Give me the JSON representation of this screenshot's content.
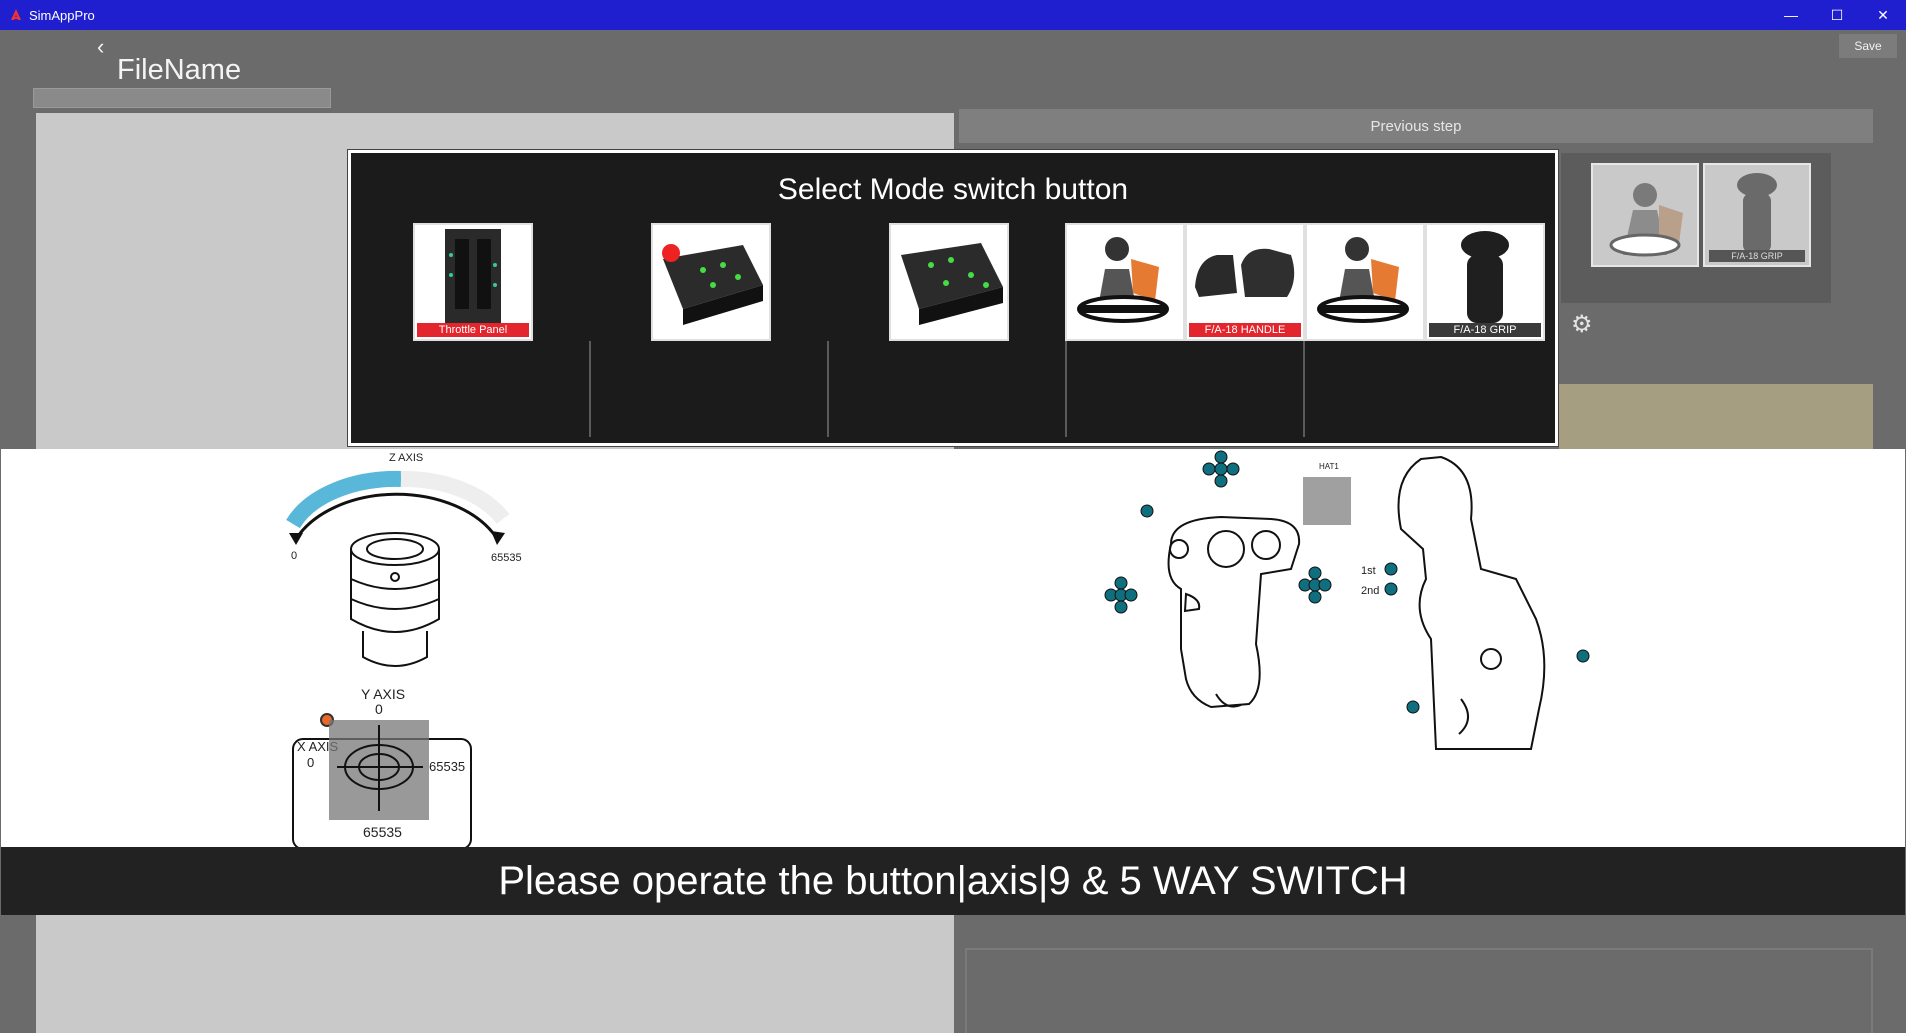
{
  "window": {
    "title": "SimAppPro",
    "minimize": "—",
    "maximize": "☐",
    "close": "✕"
  },
  "toolbar": {
    "back_icon": "‹",
    "filename": "FileName",
    "save": "Save"
  },
  "right": {
    "previous_step": "Previous step",
    "thumbs": [
      {
        "name": "orion",
        "label": ""
      },
      {
        "name": "fa18-grip",
        "label": "F/A-18 GRIP"
      }
    ]
  },
  "modal": {
    "title": "Select Mode switch button",
    "devices": [
      {
        "name": "throttle-panel",
        "label": "Throttle Panel",
        "label_style": "red"
      },
      {
        "name": "control-panel-1",
        "label": ""
      },
      {
        "name": "control-panel-2",
        "label": ""
      },
      {
        "name": "orion-1",
        "label": ""
      },
      {
        "name": "fa18-handle",
        "label": "F/A-18 HANDLE",
        "label_style": "red"
      },
      {
        "name": "orion-2",
        "label": ""
      },
      {
        "name": "fa18-grip",
        "label": "F/A-18 GRIP",
        "label_style": "dark"
      }
    ]
  },
  "diagram": {
    "z_axis": "Z AXIS",
    "z_min": "0",
    "z_max": "65535",
    "y_axis": "Y AXIS",
    "y_min": "0",
    "y_max": "65535",
    "x_axis": "X AXIS",
    "x_min": "0",
    "x_max": "65535",
    "hat_label": "HAT1",
    "first_label": "1st",
    "second_label": "2nd"
  },
  "prompt": "Please operate the button|axis|9 & 5 WAY SWITCH",
  "colors": {
    "titlebar": "#1f1fd0",
    "accent_teal": "#0f6f7e",
    "z_axis_fill": "#59b7da",
    "indicator_orange": "#e8692a",
    "red_label": "#e3262e"
  }
}
